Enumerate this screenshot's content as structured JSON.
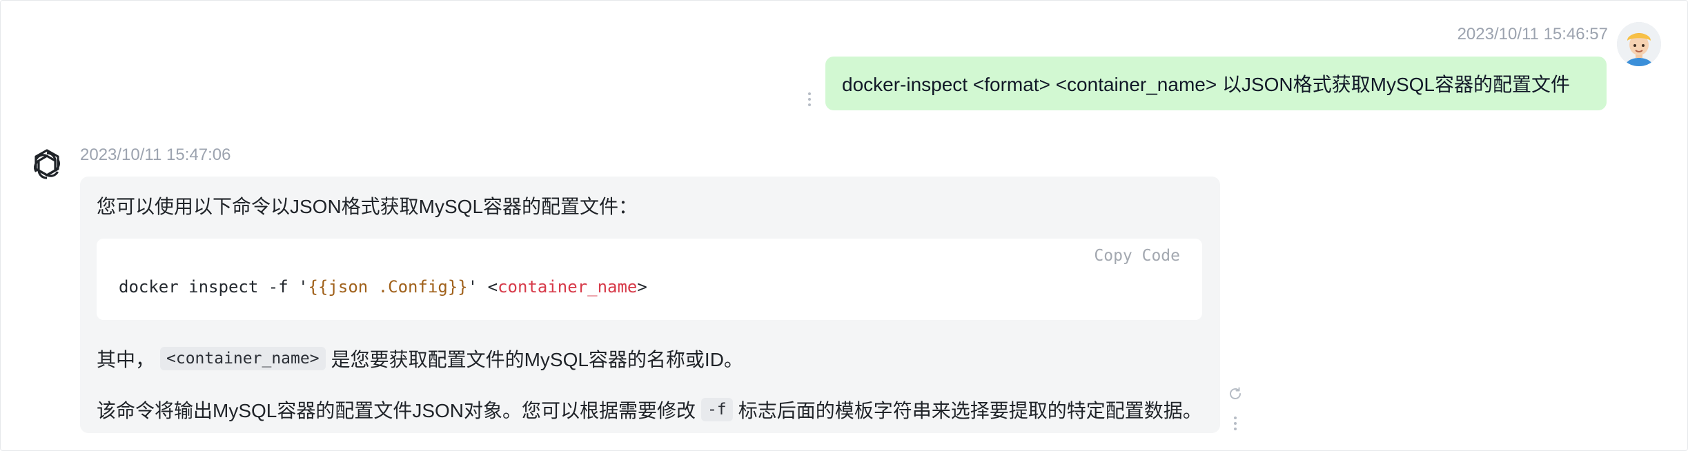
{
  "user_message": {
    "timestamp": "2023/10/11 15:46:57",
    "text": "docker-inspect <format> <container_name> 以JSON格式获取MySQL容器的配置文件",
    "avatar_icon": "user-avatar-cartoon"
  },
  "assistant_message": {
    "timestamp": "2023/10/11 15:47:06",
    "avatar_icon": "openai-logo-icon",
    "intro": "您可以使用以下命令以JSON格式获取MySQL容器的配置文件：",
    "code_block": {
      "copy_label": "Copy Code",
      "prefix": "docker inspect -f '",
      "template": "{{json .Config}}",
      "mid": "' <",
      "placeholder": "container_name",
      "suffix": ">"
    },
    "para2": {
      "before": "其中，",
      "code": "<container_name>",
      "after": "是您要获取配置文件的MySQL容器的名称或ID。"
    },
    "para3": {
      "before": "该命令将输出MySQL容器的配置文件JSON对象。您可以根据需要修改",
      "code": "-f",
      "after": "标志后面的模板字符串来选择要提取的特定配置数据。"
    }
  },
  "colors": {
    "user_bubble": "#d2f8d2",
    "assistant_bubble": "#f4f5f6",
    "timestamp": "#9ca3af",
    "code_template": "#a0611b",
    "code_placeholder": "#d73a49"
  }
}
